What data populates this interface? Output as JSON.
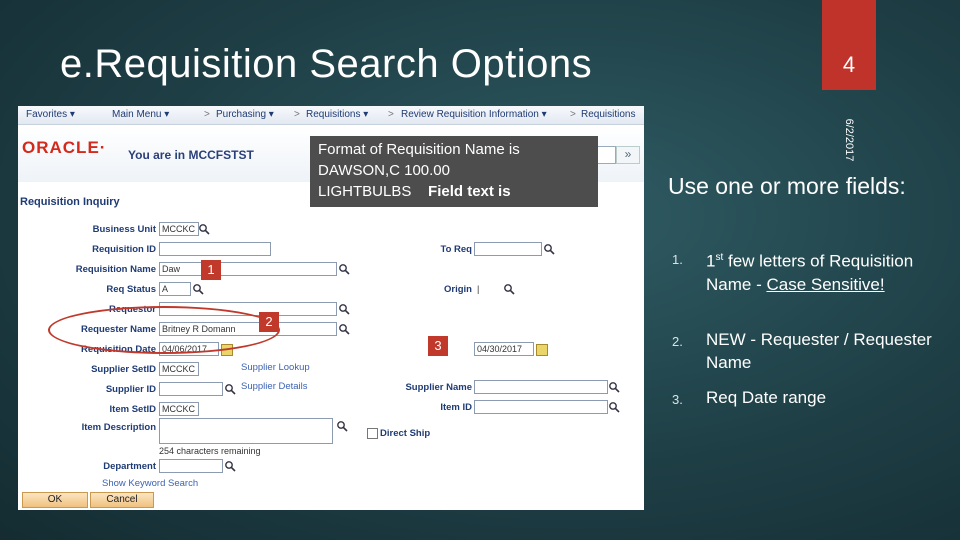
{
  "slide": {
    "title": "e.Requisition Search Options",
    "page_number": "4",
    "date": "6/2/2017"
  },
  "screenshot": {
    "nav": {
      "favorites": "Favorites ▾",
      "main_menu": "Main Menu ▾",
      "purchasing": "Purchasing ▾",
      "requisitions": "Requisitions ▾",
      "review": "Review Requisition Information ▾",
      "requisitions2": "Requisitions",
      "sep": ">"
    },
    "logo": "ORACLE·",
    "you_are_in": "You are in MCCFSTST",
    "search_arrows": "»",
    "page_title": "Requisition Inquiry",
    "labels": {
      "business_unit": "Business Unit",
      "requisition_id": "Requisition ID",
      "requisition_name": "Requisition Name",
      "req_status": "Req Status",
      "requestor": "Requestor",
      "requester_name": "Requester Name",
      "requisition_date": "Requisition Date",
      "supplier_setid": "Supplier SetID",
      "supplier_id": "Supplier ID",
      "item_setid": "Item SetID",
      "item_description": "Item Description",
      "department": "Department",
      "to_req": "To Req",
      "origin": "Origin",
      "supplier_name": "Supplier Name",
      "item_id": "Item ID",
      "direct_ship": "Direct Ship"
    },
    "values": {
      "business_unit": "MCCKC",
      "requisition_name": "Daw",
      "req_status": "A",
      "requester_name": "Britney R Domann",
      "requisition_date": "04/06/2017",
      "to_date": "04/30/2017",
      "supplier_setid": "MCCKC",
      "item_setid": "MCCKC",
      "origin": "|"
    },
    "links": {
      "supplier_lookup": "Supplier Lookup",
      "supplier_details": "Supplier Details",
      "chars_remaining": "254 characters remaining",
      "show_keyword": "Show Keyword Search"
    },
    "buttons": {
      "ok": "OK",
      "cancel": "Cancel"
    }
  },
  "callout": {
    "line1": "Format of Requisition Name is",
    "line2": "DAWSON,C 100.00",
    "line3a": "LIGHTBULBS",
    "line3b": "Field text is"
  },
  "badges": [
    "1",
    "2",
    "3"
  ],
  "right_panel": {
    "heading": "Use one or more fields:",
    "items": [
      {
        "num": "1.",
        "text_a": "1",
        "sup": "st",
        "text_b": " few letters of Requisition Name -",
        "underlined": "Case Sensitive!"
      },
      {
        "num": "2.",
        "text": "NEW - Requester / Requester Name"
      },
      {
        "num": "3.",
        "text": "Req Date range"
      }
    ]
  },
  "colors": {
    "accent_red": "#c0332b",
    "background": "#1e3e45",
    "callout_bg": "#4d4d4d"
  }
}
